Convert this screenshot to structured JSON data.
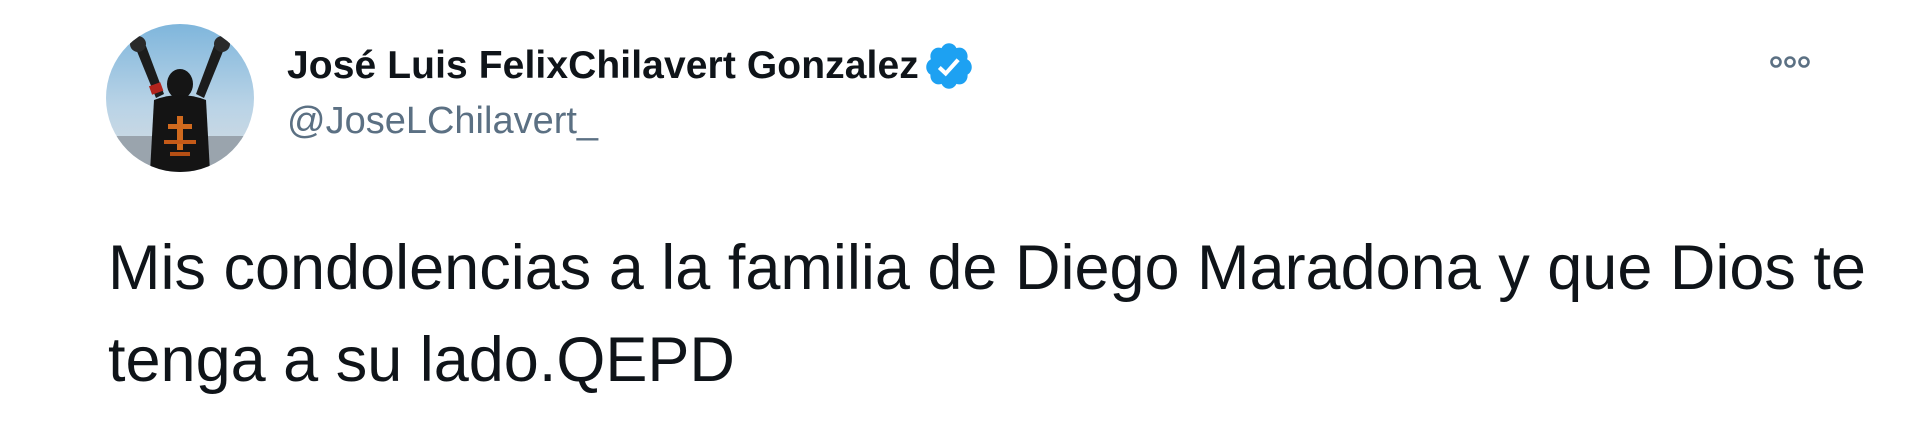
{
  "tweet": {
    "author": {
      "display_name": "José Luis FelixChilavert Gonzalez",
      "handle": "@JoseLChilavert_",
      "verified": true,
      "avatar_icon": "avatar-goalkeeper-photo"
    },
    "more_icon": "ellipsis-horizontal-icon",
    "text": "Mis condolencias a la familia de Diego Maradona y que Dios te tenga a su lado.QEPD"
  },
  "colors": {
    "verified_badge": "#1da1f2",
    "handle_text": "#5b7083",
    "body_text": "#0f1419",
    "background": "#ffffff"
  }
}
